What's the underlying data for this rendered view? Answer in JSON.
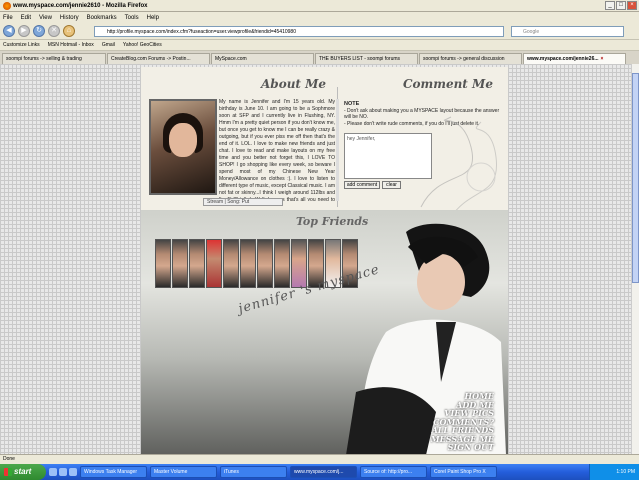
{
  "window": {
    "title": "www.myspace.com/jennie2610 - Mozilla Firefox"
  },
  "menu": [
    "File",
    "Edit",
    "View",
    "History",
    "Bookmarks",
    "Tools",
    "Help"
  ],
  "nav": {
    "url": "http://profile.myspace.com/index.cfm?fuseaction=user.viewprofile&friendid=45410980",
    "search_placeholder": "Google"
  },
  "bookmarks": [
    "Customize Links",
    "MSN Hotmail - Inbox",
    "Gmail",
    "Yahoo! GeoCities"
  ],
  "tabs": [
    {
      "label": "soompi forums -> selling & trading",
      "active": false
    },
    {
      "label": "CreateBlog.com Forums -> Postin...",
      "active": false
    },
    {
      "label": "MySpace.com",
      "active": false
    },
    {
      "label": "THE BUYERS LIST - soompi forums",
      "active": false
    },
    {
      "label": "soompi forums -> general discussion",
      "active": false
    },
    {
      "label": "www.myspace.com/jennie26...",
      "active": true
    }
  ],
  "profile": {
    "about_title": "About Me",
    "comment_title": "Comment Me",
    "about_text": "My name is Jennifer and I'm 15 years old. My birthday is June 10. I am going to be a Sophmore soon at SFP and I currently live in Flushing, NY. Hmm I'm a pretty quiet person if you don't know me, but once you get to know me I can be really crazy & outgoing, but if you ever piss me off then that's the end of it. LOL. I love to make new friends and just chat. I love to read and make layouts on my free time and you better not forget this, I LOVE TO SHOP! I go shopping like every week, so beware I spend most of my Chinese New Year Money/Allowance on clothes :). I love to listen to different type of music, except Classical music. I am not fat or skinny...I think I weigh around 112lbs and I'm 5' 8\" tall :). Well, I guess that's all you need to know about me!",
    "player_label": "Stream | Song: Put",
    "note_heading": "NOTE",
    "note_lines": [
      "- Don't ask about making you a MYSPACE layout because the answer will be NO.",
      "- Please don't write rude comments, if you do I'll just delete it."
    ],
    "comment_placeholder": "hey Jennifer,",
    "add_comment": "add comment",
    "clear": "clear",
    "top_friends_title": "Top Friends",
    "banner_text": "jennifer 's myspace",
    "links": [
      "HOME",
      "ADD ME",
      "VIEW PICS",
      "COMMENTS?",
      "ALL FRIENDS",
      "MESSAGE ME",
      "SIGN OUT"
    ]
  },
  "status": "Done",
  "taskbar": {
    "start": "start",
    "tasks": [
      "Windows Task Manager",
      "Master Volume",
      "iTunes",
      "www.myspace.com/j...",
      "Source of: http://pro...",
      "Corel Paint Shop Pro X"
    ],
    "clock": "1:10 PM"
  }
}
